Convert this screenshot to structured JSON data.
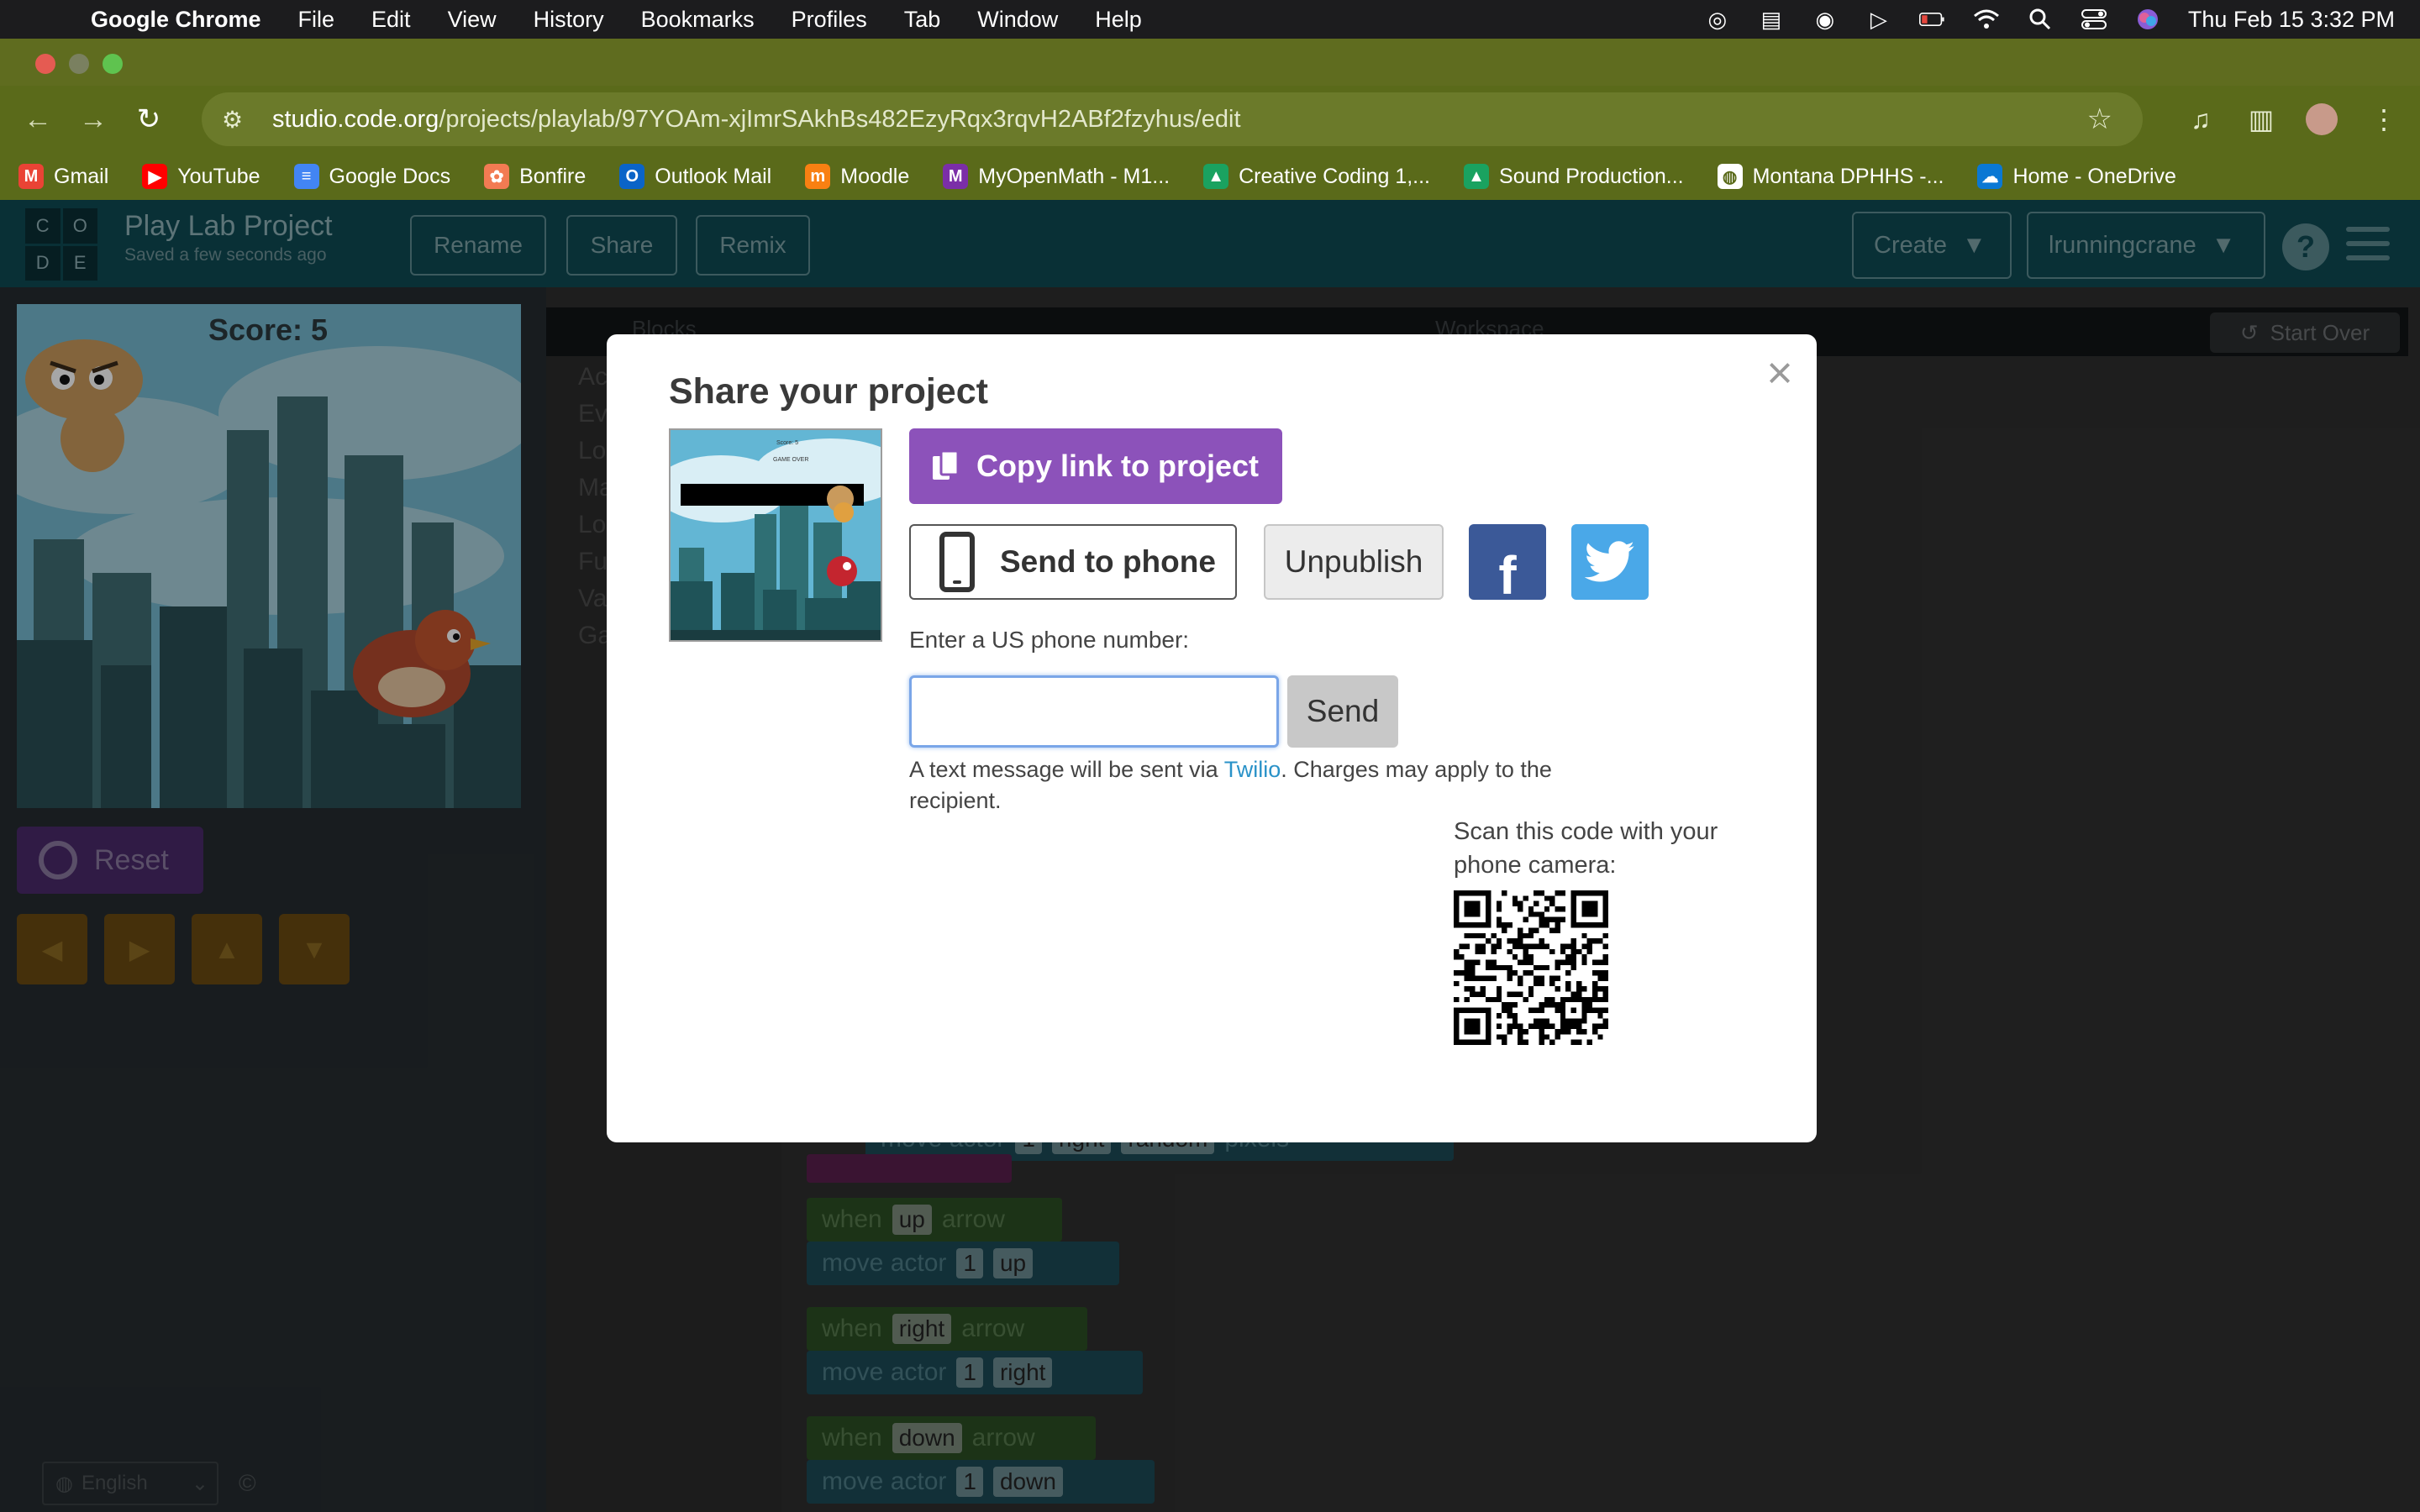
{
  "menubar": {
    "app_name": "Google Chrome",
    "items": [
      "File",
      "Edit",
      "View",
      "History",
      "Bookmarks",
      "Profiles",
      "Tab",
      "Window",
      "Help"
    ],
    "datetime": "Thu Feb 15  3:32 PM"
  },
  "browser": {
    "url_domain": "studio.code.org",
    "url_path": "/projects/playlab/97YOAm-xjImrSAkhBs482EzyRqx3rqvH2ABf2fzyhus/edit",
    "bookmarks": [
      {
        "label": "Gmail",
        "color": "#ea4335",
        "glyph": "M"
      },
      {
        "label": "YouTube",
        "color": "#ff0000",
        "glyph": "▶"
      },
      {
        "label": "Google Docs",
        "color": "#4285f4",
        "glyph": "≡"
      },
      {
        "label": "Bonfire",
        "color": "#f27b53",
        "glyph": "✿"
      },
      {
        "label": "Outlook Mail",
        "color": "#0a64c8",
        "glyph": "O"
      },
      {
        "label": "Moodle",
        "color": "#f98012",
        "glyph": "m"
      },
      {
        "label": "MyOpenMath - M1...",
        "color": "#7b2ea8",
        "glyph": "M"
      },
      {
        "label": "Creative Coding 1,...",
        "color": "#1aa260",
        "glyph": "▲"
      },
      {
        "label": "Sound Production...",
        "color": "#1aa260",
        "glyph": "▲"
      },
      {
        "label": "Montana DPHHS -...",
        "color": "#ffffff",
        "glyph": "◍"
      },
      {
        "label": "Home - OneDrive",
        "color": "#0a78d4",
        "glyph": "☁"
      }
    ]
  },
  "header": {
    "logo_letters": [
      "C",
      "O",
      "D",
      "E"
    ],
    "project_title": "Play Lab Project",
    "saved_status": "Saved a few seconds ago",
    "buttons": {
      "rename": "Rename",
      "share": "Share",
      "remix": "Remix"
    },
    "create_label": "Create",
    "username": "lrunningcrane",
    "help": "?"
  },
  "game": {
    "score": "Score: 5",
    "reset_label": "Reset",
    "arrows": [
      "◀",
      "▶",
      "▲",
      "▼"
    ]
  },
  "workspace": {
    "blocks_label": "Blocks",
    "workspace_label": "Workspace",
    "start_over": "Start Over",
    "toolbox": [
      "Ac",
      "Ev",
      "Lo",
      "Ma",
      "Lo",
      "Fu",
      "Va",
      "Ga"
    ],
    "partial_block": {
      "text": "move actor",
      "a": "1",
      "b": "right",
      "c": "random",
      "d": "pixels"
    },
    "handlers": [
      {
        "when": "when",
        "key": "up",
        "arrow": "arrow",
        "move": "move actor",
        "actor": "1",
        "dir": "up"
      },
      {
        "when": "when",
        "key": "right",
        "arrow": "arrow",
        "move": "move actor",
        "actor": "1",
        "dir": "right"
      },
      {
        "when": "when",
        "key": "down",
        "arrow": "arrow",
        "move": "move actor",
        "actor": "1",
        "dir": "down"
      }
    ]
  },
  "footer": {
    "language": "English",
    "copyright": "©"
  },
  "modal": {
    "title": "Share your project",
    "close": "×",
    "copy_link": "Copy link to project",
    "send_to_phone": "Send to phone",
    "unpublish": "Unpublish",
    "facebook": "f",
    "phone_label": "Enter a US phone number:",
    "phone_value": "",
    "send": "Send",
    "sms_note_before": "A text message will be sent via ",
    "sms_note_link": "Twilio",
    "sms_note_after": ". Charges may apply to the recipient.",
    "qr_label": "Scan this code with your phone camera:",
    "thumb_score": "Score: 5",
    "thumb_game_over": "GAME OVER"
  },
  "colors": {
    "copy_link_bg": "#8c52ba",
    "facebook": "#3b5998",
    "twitter": "#4aa8e8",
    "link": "#2a92c8"
  }
}
